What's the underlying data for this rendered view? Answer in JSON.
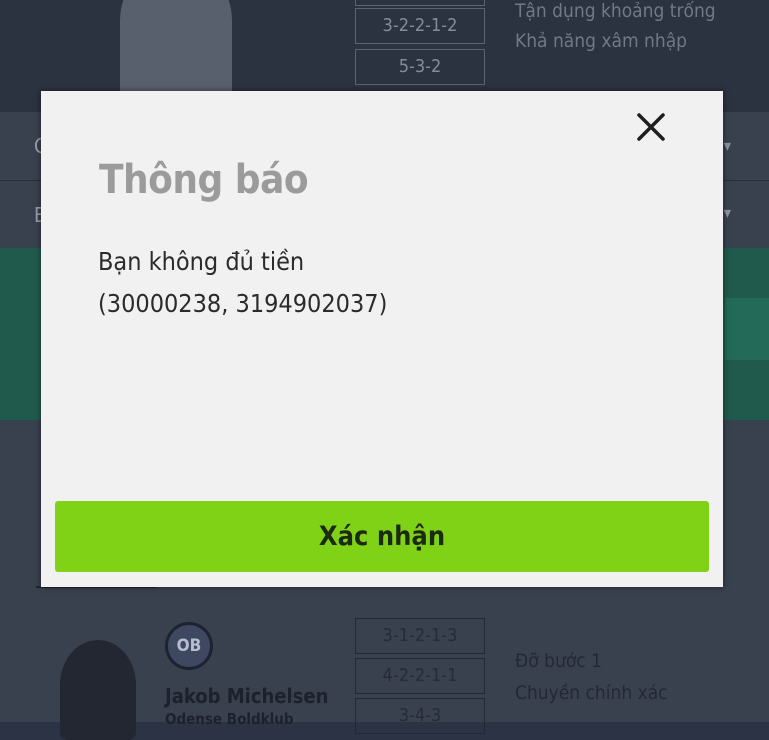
{
  "background": {
    "top_card": {
      "formations": [
        "3-2-2-1-2",
        "5-3-2"
      ],
      "traits": [
        "Tận dụng khoảng trống",
        "Khả năng xâm nhập"
      ]
    },
    "row1_letter": "C",
    "row2_letter": "B",
    "bottom_card": {
      "club_badge": "OB",
      "player_name": "Jakob Michelsen",
      "club_name": "Odense Boldklub",
      "formations": [
        "3-1-2-1-3",
        "4-2-2-1-1",
        "3-4-3"
      ],
      "traits": [
        "Đỡ bước 1",
        "Chuyền chính xác"
      ]
    }
  },
  "modal": {
    "title": "Thông báo",
    "message_line1": "Bạn không đủ tiền",
    "message_line2": "(30000238, 3194902037)",
    "confirm_label": "Xác nhận",
    "accent_color": "#80d216",
    "close_icon": "close-icon"
  }
}
